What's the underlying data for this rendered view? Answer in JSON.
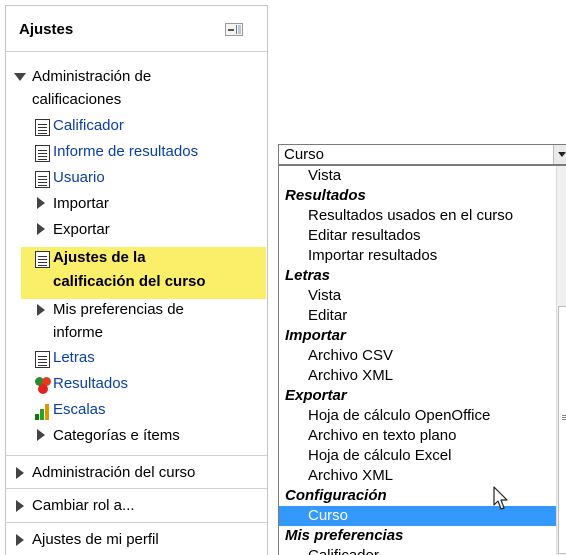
{
  "block": {
    "title": "Ajustes",
    "grade_admin_line1": "Administración de",
    "grade_admin_line2": "calificaciones",
    "items": {
      "calificador": "Calificador",
      "informe_resultados": "Informe de resultados",
      "usuario": "Usuario",
      "importar": "Importar",
      "exportar": "Exportar",
      "ajustes_line1": "Ajustes de la",
      "ajustes_line2": "calificación del curso",
      "mis_pref_line1": "Mis preferencias de",
      "mis_pref_line2": "informe",
      "letras": "Letras",
      "resultados": "Resultados",
      "escalas": "Escalas",
      "categorias": "Categorías e ítems"
    },
    "sections": {
      "admin_curso": "Administración del curso",
      "cambiar_rol": "Cambiar rol a...",
      "ajustes_perfil": "Ajustes de mi perfil"
    },
    "colors": {
      "highlight": "#fbef6a",
      "link": "#0a3ea8"
    }
  },
  "select": {
    "value": "Curso",
    "options": [
      {
        "label": "Vista",
        "kind": "item"
      },
      {
        "label": "Resultados",
        "kind": "group"
      },
      {
        "label": "Resultados usados en el curso",
        "kind": "item"
      },
      {
        "label": "Editar resultados",
        "kind": "item"
      },
      {
        "label": "Importar resultados",
        "kind": "item"
      },
      {
        "label": "Letras",
        "kind": "group"
      },
      {
        "label": "Vista",
        "kind": "item"
      },
      {
        "label": "Editar",
        "kind": "item"
      },
      {
        "label": "Importar",
        "kind": "group"
      },
      {
        "label": "Archivo CSV",
        "kind": "item"
      },
      {
        "label": "Archivo XML",
        "kind": "item"
      },
      {
        "label": "Exportar",
        "kind": "group"
      },
      {
        "label": "Hoja de cálculo OpenOffice",
        "kind": "item"
      },
      {
        "label": "Archivo en texto plano",
        "kind": "item"
      },
      {
        "label": "Hoja de cálculo Excel",
        "kind": "item"
      },
      {
        "label": "Archivo XML",
        "kind": "item"
      },
      {
        "label": "Configuración",
        "kind": "group"
      },
      {
        "label": "Curso",
        "kind": "item",
        "selected": true
      },
      {
        "label": "Mis preferencias",
        "kind": "group"
      },
      {
        "label": "Calificador",
        "kind": "item"
      }
    ],
    "selected_color": "#3399ff"
  }
}
